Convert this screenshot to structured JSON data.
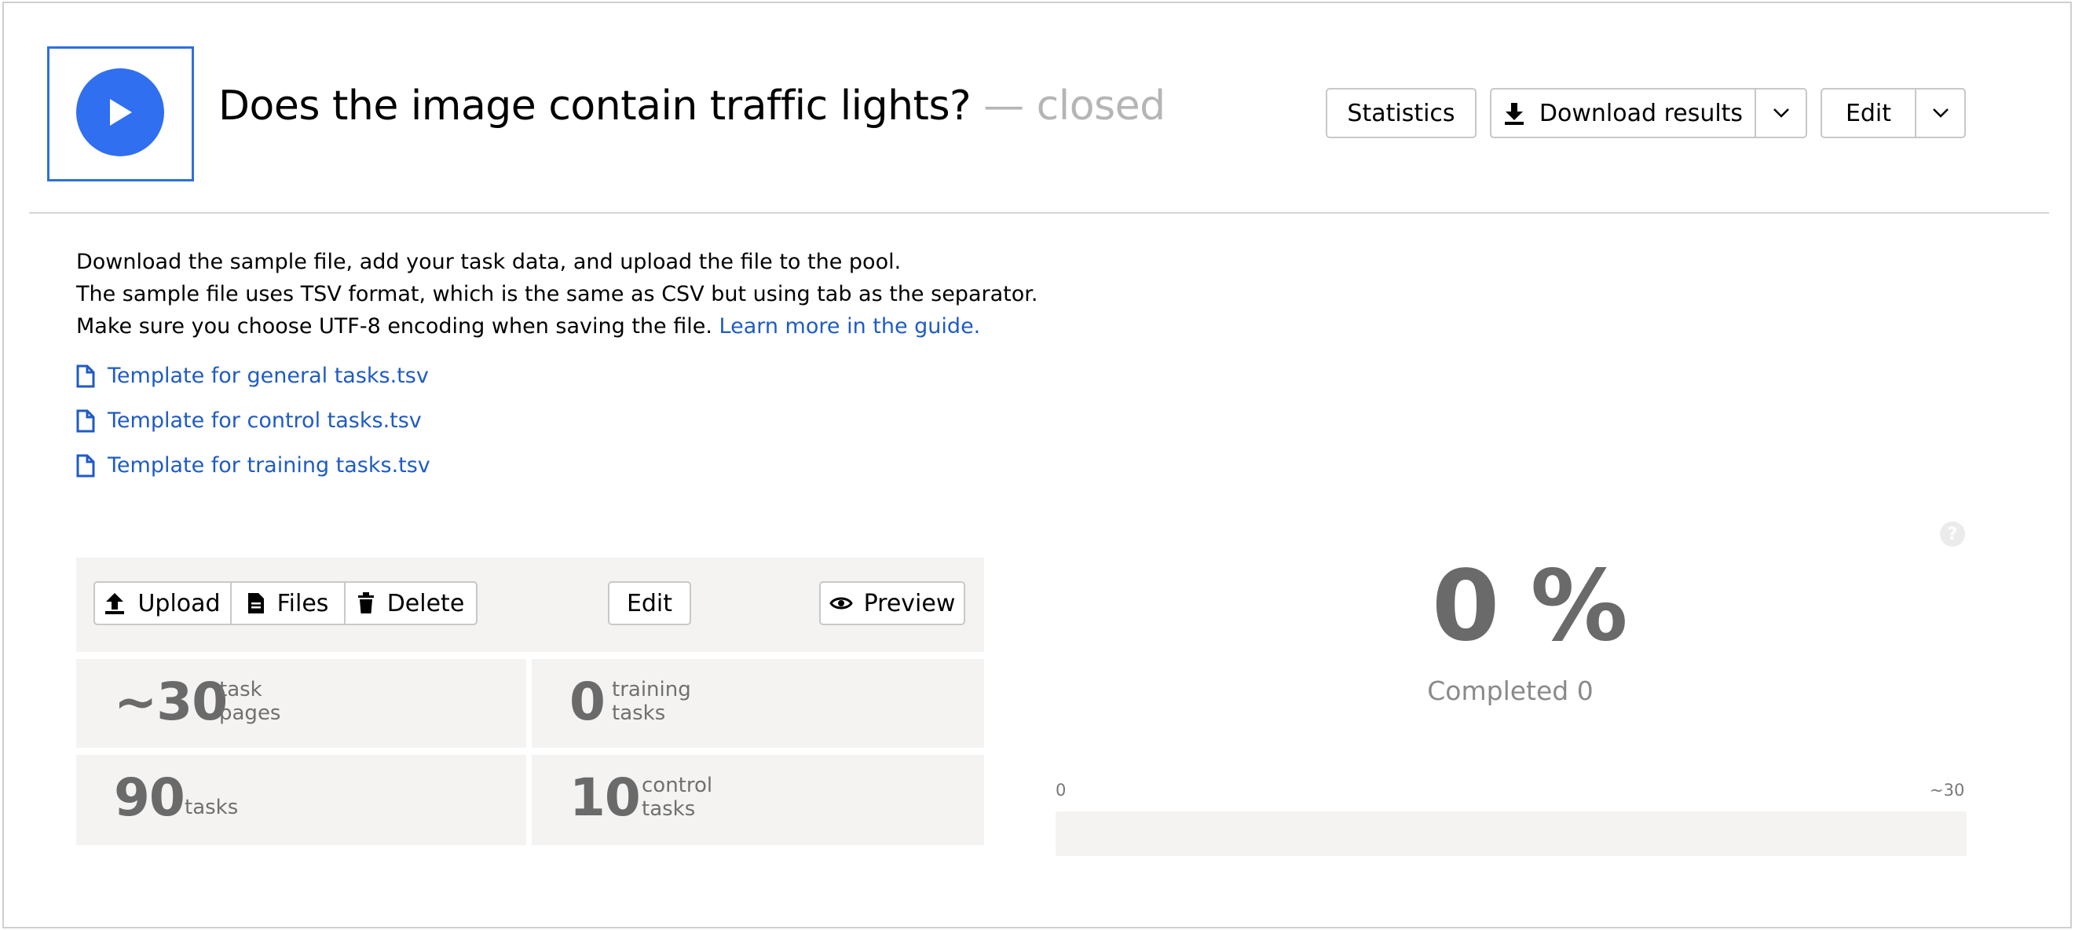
{
  "header": {
    "title": "Does the image contain traffic lights?",
    "status": "— closed",
    "icon": "play-icon",
    "buttons": {
      "statistics": "Statistics",
      "download_results": "Download results",
      "edit": "Edit"
    }
  },
  "instructions": {
    "line1": "Download the sample file, add your task data, and upload the file to the pool.",
    "line2": "The sample file uses TSV format, which is the same as CSV but using tab as the separator.",
    "line3": "Make sure you choose UTF-8 encoding when saving the file.",
    "guide_link": "Learn more in the guide."
  },
  "templates": [
    {
      "label": "Template for general tasks.tsv",
      "icon": "file-icon"
    },
    {
      "label": "Template for control tasks.tsv",
      "icon": "file-icon"
    },
    {
      "label": "Template for training tasks.tsv",
      "icon": "file-icon"
    }
  ],
  "toolbar": {
    "upload": "Upload",
    "files": "Files",
    "delete": "Delete",
    "edit": "Edit",
    "preview": "Preview"
  },
  "stats": {
    "task_pages": {
      "value": "~30",
      "label_line1": "task",
      "label_line2": "pages"
    },
    "training_tasks": {
      "value": "0",
      "label_line1": "training",
      "label_line2": "tasks"
    },
    "tasks": {
      "value": "90",
      "label": "tasks"
    },
    "control_tasks": {
      "value": "10",
      "label_line1": "control",
      "label_line2": "tasks"
    }
  },
  "progress": {
    "percent_text": "0 %",
    "completed": "Completed 0",
    "axis_min": "0",
    "axis_max": "~30",
    "fraction": 0,
    "help": "?"
  },
  "colors": {
    "accent": "#2f6ff0",
    "link": "#1f5bc4",
    "panel_bg": "#f4f3f1",
    "muted_text": "#b5b5b5"
  }
}
